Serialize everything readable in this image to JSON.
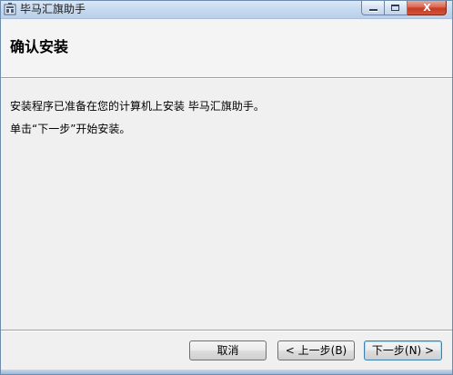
{
  "window": {
    "title": "毕马汇旗助手",
    "icon": "installer-package-icon"
  },
  "caption_buttons": {
    "minimize": "minimize-icon",
    "maximize": "maximize-icon",
    "close": "close-icon",
    "close_glyph": "X",
    "close_color": "#c6391f"
  },
  "header": {
    "title": "确认安装"
  },
  "body": {
    "line1": "安装程序已准备在您的计算机上安装 毕马汇旗助手。",
    "line2": "单击“下一步”开始安装。"
  },
  "buttons": {
    "cancel": "取消",
    "back": "< 上一步(B)",
    "next": "下一步(N) >"
  }
}
